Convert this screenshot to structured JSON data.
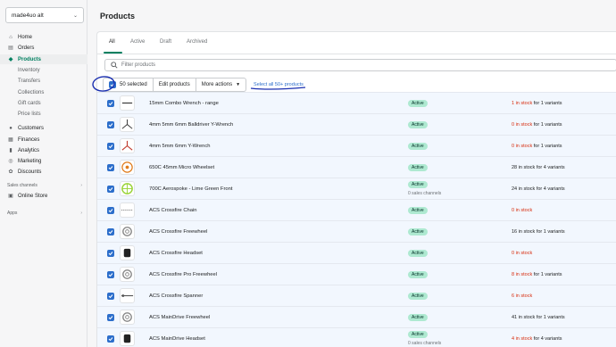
{
  "store": {
    "name": "made4uo alt"
  },
  "nav": {
    "items": [
      {
        "label": "Home",
        "icon": "home-icon"
      },
      {
        "label": "Orders",
        "icon": "orders-icon"
      },
      {
        "label": "Products",
        "icon": "tag-icon"
      },
      {
        "label": "Inventory"
      },
      {
        "label": "Transfers"
      },
      {
        "label": "Collections"
      },
      {
        "label": "Gift cards"
      },
      {
        "label": "Price lists"
      },
      {
        "label": "Customers",
        "icon": "customers-icon"
      },
      {
        "label": "Finances",
        "icon": "finances-icon"
      },
      {
        "label": "Analytics",
        "icon": "analytics-icon"
      },
      {
        "label": "Marketing",
        "icon": "marketing-icon"
      },
      {
        "label": "Discounts",
        "icon": "discounts-icon"
      }
    ],
    "sales_channels_label": "Sales channels",
    "online_store": "Online Store",
    "apps_label": "Apps"
  },
  "page": {
    "title": "Products"
  },
  "tabs": [
    "All",
    "Active",
    "Draft",
    "Archived"
  ],
  "search": {
    "placeholder": "Filter products"
  },
  "bulk": {
    "selected": "50 selected",
    "edit": "Edit products",
    "more": "More actions",
    "select_all": "Select all 50+ products"
  },
  "rows": [
    {
      "name": "15mm Combo Wrench - range",
      "status": "Active",
      "channels": "",
      "stock": "1 in stock",
      "variants": " for 1 variants",
      "low": true,
      "thumb": "wrench-icon"
    },
    {
      "name": "4mm 5mm 6mm Balldriver Y-Wrench",
      "status": "Active",
      "channels": "",
      "stock": "0 in stock",
      "variants": " for 1 variants",
      "low": true,
      "thumb": "y-wrench-icon"
    },
    {
      "name": "4mm 5mm 6mm Y-Wrench",
      "status": "Active",
      "channels": "",
      "stock": "0 in stock",
      "variants": " for 1 variants",
      "low": true,
      "thumb": "red-y-wrench-icon"
    },
    {
      "name": "650C 45mm Micro Wheelset",
      "status": "Active",
      "channels": "",
      "stock": "28 in stock for 4 variants",
      "variants": "",
      "low": false,
      "thumb": "wheelset-icon"
    },
    {
      "name": "700C Aerospoke - Lime Green Front",
      "status": "Active",
      "channels": "0 sales channels",
      "stock": "24 in stock for 4 variants",
      "variants": "",
      "low": false,
      "thumb": "wheel-icon"
    },
    {
      "name": "ACS Crossfire Chain",
      "status": "Active",
      "channels": "",
      "stock": "0 in stock",
      "variants": "",
      "low": true,
      "thumb": "chain-icon"
    },
    {
      "name": "ACS Crossfire Freewheel",
      "status": "Active",
      "channels": "",
      "stock": "16 in stock for 1 variants",
      "variants": "",
      "low": false,
      "thumb": "freewheel-icon"
    },
    {
      "name": "ACS Crossfire Headset",
      "status": "Active",
      "channels": "",
      "stock": "0 in stock",
      "variants": "",
      "low": true,
      "thumb": "headset-icon"
    },
    {
      "name": "ACS Crossfire Pro Freewheel",
      "status": "Active",
      "channels": "",
      "stock": "8 in stock",
      "variants": " for 1 variants",
      "low": true,
      "thumb": "freewheel-icon"
    },
    {
      "name": "ACS Crossfire Spanner",
      "status": "Active",
      "channels": "",
      "stock": "6 in stock",
      "variants": "",
      "low": true,
      "thumb": "spanner-icon"
    },
    {
      "name": "ACS MainDrive Freewheel",
      "status": "Active",
      "channels": "",
      "stock": "41 in stock for 1 variants",
      "variants": "",
      "low": false,
      "thumb": "freewheel-icon"
    },
    {
      "name": "ACS MainDrive Headset",
      "status": "Active",
      "channels": "0 sales channels",
      "stock": "4 in stock",
      "variants": " for 4 variants",
      "low": true,
      "thumb": "headset-icon"
    }
  ],
  "colors": {
    "accent": "#008060",
    "link": "#2c6ecb",
    "badge": "#aee9d1",
    "low_stock": "#d72c0d",
    "annotation": "#1a2fb0"
  }
}
